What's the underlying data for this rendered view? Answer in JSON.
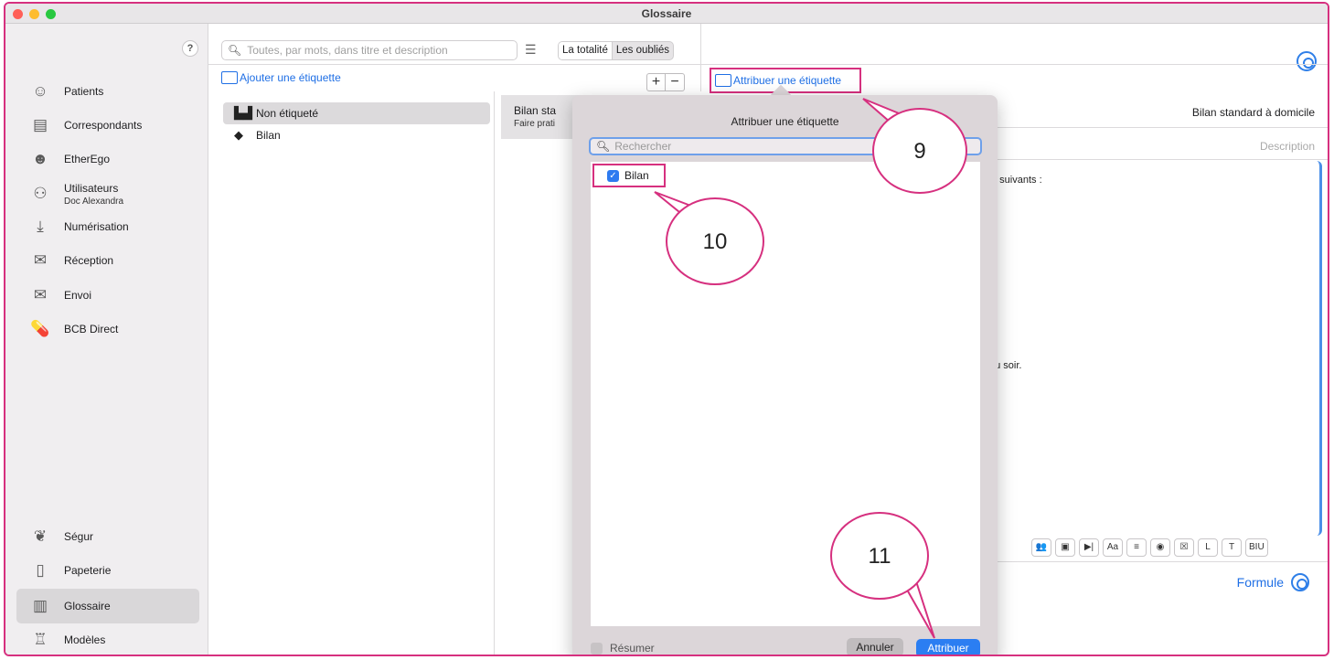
{
  "window": {
    "title": "Glossaire"
  },
  "sidebar": {
    "help": "?",
    "items": [
      {
        "label": "Patients",
        "icon": "smiley-icon"
      },
      {
        "label": "Correspondants",
        "icon": "contacts-icon"
      },
      {
        "label": "EtherEgo",
        "icon": "users-icon"
      },
      {
        "label": "Utilisateurs",
        "sub": "Doc Alexandra",
        "icon": "group-icon"
      },
      {
        "label": "Numérisation",
        "icon": "scan-icon"
      },
      {
        "label": "Réception",
        "icon": "inbox-icon"
      },
      {
        "label": "Envoi",
        "icon": "outbox-icon"
      },
      {
        "label": "BCB Direct",
        "icon": "pill-icon"
      },
      {
        "label": "Ségur",
        "icon": "segur-icon"
      },
      {
        "label": "Papeterie",
        "icon": "page-icon"
      },
      {
        "label": "Glossaire",
        "icon": "book-icon"
      },
      {
        "label": "Modèles",
        "icon": "template-icon"
      }
    ]
  },
  "toolbar": {
    "search_placeholder": "Toutes, par mots, dans titre et description",
    "seg_all": "La totalité",
    "seg_forgotten": "Les oubliés",
    "add_tag": "Ajouter une étiquette",
    "assign_tag": "Attribuer une étiquette",
    "plus": "+",
    "minus": "−"
  },
  "tags_list": [
    {
      "label": "Non étiqueté",
      "icon": "book-open-icon"
    },
    {
      "label": "Bilan",
      "icon": "tag-icon"
    }
  ],
  "entry": {
    "title": "Bilan sta",
    "subtitle": "Faire prati",
    "doc_title": "Bilan standard à domicile",
    "description_placeholder": "Description",
    "fragment_1": "e suivants :",
    "fragment_2": "du soir.",
    "formule": "Formule"
  },
  "format_toolbar": [
    "👥",
    "▣",
    "▶|",
    "Aa",
    "≡",
    "◉",
    "☒",
    "L",
    "T",
    "BIU"
  ],
  "dialog": {
    "title": "Attribuer une étiquette",
    "search_placeholder": "Rechercher",
    "items": [
      {
        "label": "Bilan",
        "checked": true
      }
    ],
    "summarize": "Résumer",
    "cancel": "Annuler",
    "confirm": "Attribuer"
  },
  "callouts": [
    "9",
    "10",
    "11"
  ]
}
